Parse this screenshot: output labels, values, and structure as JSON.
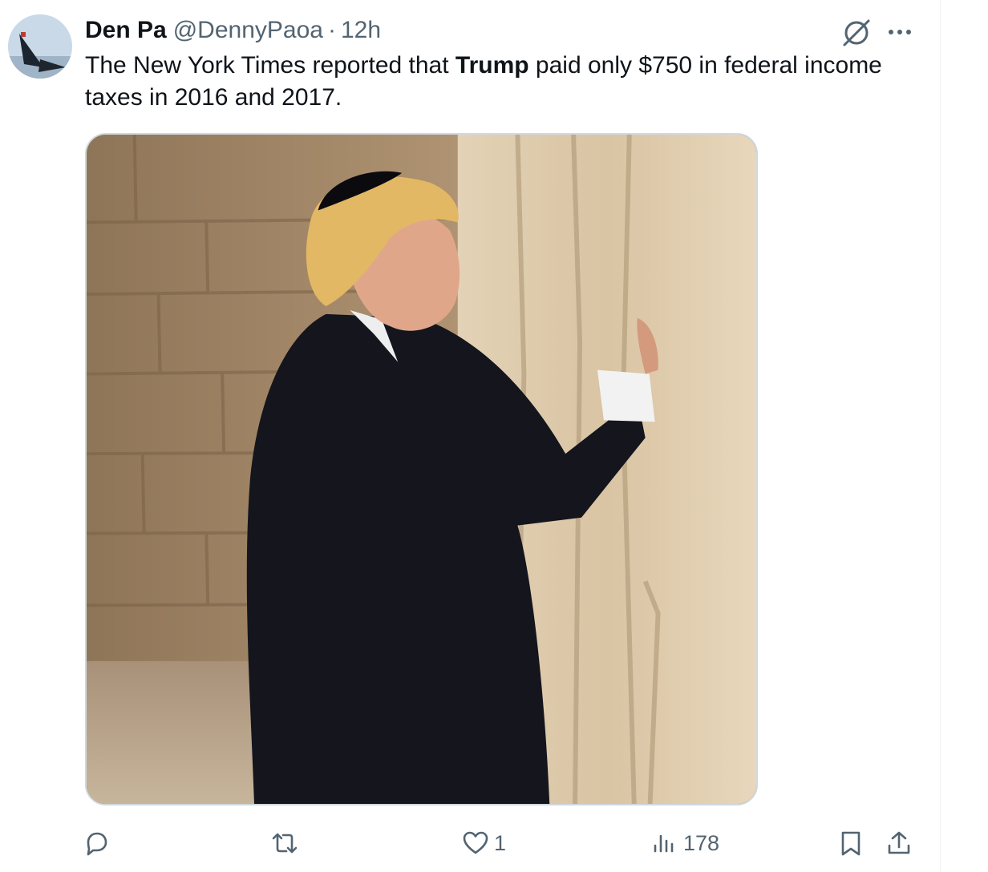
{
  "tweet": {
    "author_name": "Den Pa",
    "handle": "@DennyPaoa",
    "separator": "·",
    "time": "12h",
    "text_before": "The New York Times reported  that ",
    "text_bold": "Trump",
    "text_after": " paid only $750 in federal income taxes in 2016 and 2017."
  },
  "icons": {
    "grok": "grok-icon",
    "more": "more-icon",
    "reply": "reply-icon",
    "retweet": "retweet-icon",
    "like": "heart-icon",
    "views": "views-icon",
    "bookmark": "bookmark-icon",
    "share": "share-icon"
  },
  "actions": {
    "reply_count": "",
    "retweet_count": "",
    "like_count": "1",
    "views_count": "178"
  },
  "colors": {
    "text_primary": "#0f1419",
    "text_secondary": "#536471",
    "border": "#cfd9de"
  }
}
